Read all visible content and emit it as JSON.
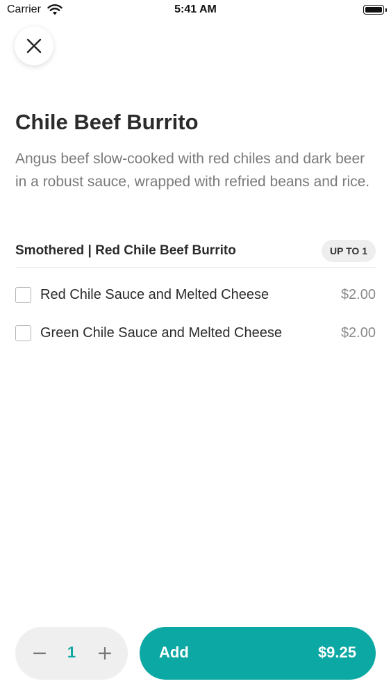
{
  "status_bar": {
    "carrier": "Carrier",
    "time": "5:41 AM"
  },
  "item": {
    "title": "Chile Beef Burrito",
    "description": "Angus beef slow-cooked with red chiles and dark beer in a robust sauce, wrapped with refried beans and rice."
  },
  "modifier_group": {
    "title": "Smothered |  Red Chile Beef Burrito",
    "badge": "UP TO 1",
    "options": [
      {
        "label": "Red Chile Sauce and Melted Cheese",
        "price": "$2.00",
        "checked": false
      },
      {
        "label": "Green Chile Sauce and Melted Cheese",
        "price": "$2.00",
        "checked": false
      }
    ]
  },
  "footer": {
    "quantity": "1",
    "add_label": "Add",
    "add_price": "$9.25"
  },
  "colors": {
    "accent": "#0ca8a3",
    "quantity_text": "#10a8a2"
  },
  "icons": [
    "wifi-icon",
    "battery-icon",
    "close-icon",
    "minus-icon",
    "plus-icon"
  ]
}
